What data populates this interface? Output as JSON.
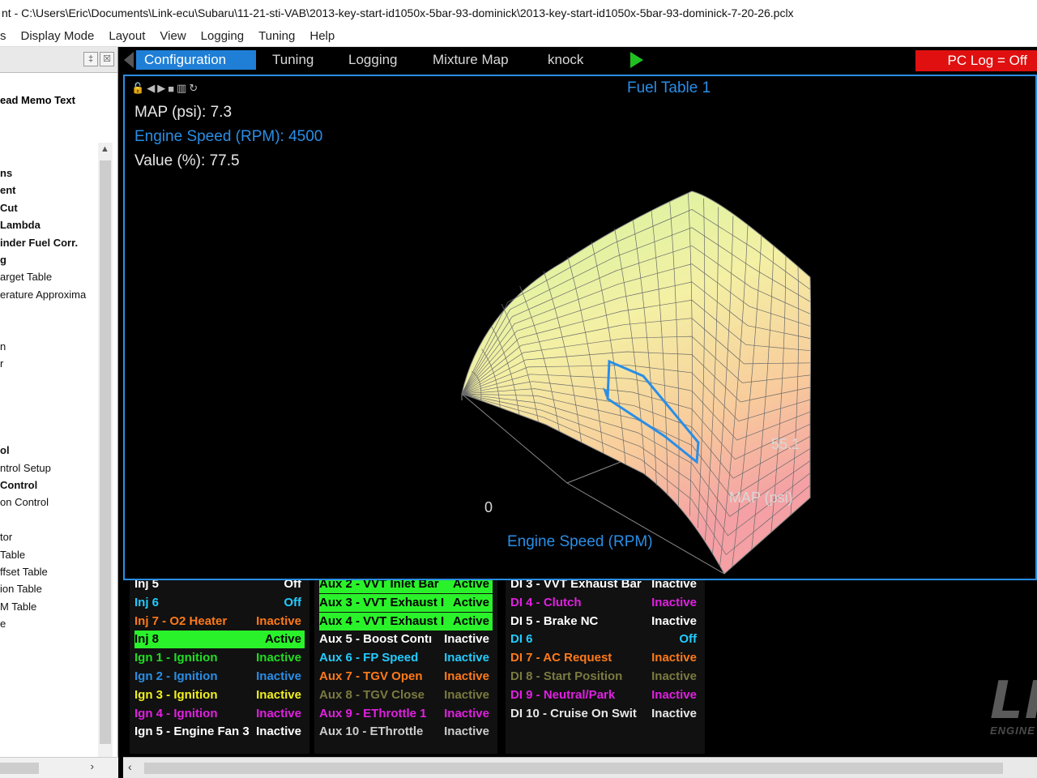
{
  "window": {
    "title": "nt - C:\\Users\\Eric\\Documents\\Link-ecu\\Subaru\\11-21-sti-VAB\\2013-key-start-id1050x-5bar-93-dominick\\2013-key-start-id1050x-5bar-93-dominick-7-20-26.pclx"
  },
  "menu": [
    "s",
    "Display Mode",
    "Layout",
    "View",
    "Logging",
    "Tuning",
    "Help"
  ],
  "left_panel": {
    "header": "ead Memo Text",
    "pin_label": "‡",
    "close_label": "☒",
    "items": [
      {
        "label": "ns",
        "bold": true
      },
      {
        "label": "ent",
        "bold": true
      },
      {
        "label": "Cut",
        "bold": true
      },
      {
        "label": "Lambda",
        "bold": true
      },
      {
        "label": "inder Fuel Corr.",
        "bold": true
      },
      {
        "label": "g",
        "bold": true
      },
      {
        "label": "arget Table",
        "bold": false
      },
      {
        "label": "erature Approxima",
        "bold": false
      },
      {
        "label": "",
        "bold": false
      },
      {
        "label": "",
        "bold": false
      },
      {
        "label": "n",
        "bold": false
      },
      {
        "label": "r",
        "bold": false
      },
      {
        "label": "",
        "bold": false
      },
      {
        "label": "",
        "bold": false
      },
      {
        "label": "",
        "bold": false
      },
      {
        "label": "",
        "bold": false
      },
      {
        "label": "ol",
        "bold": true
      },
      {
        "label": "ntrol Setup",
        "bold": false
      },
      {
        "label": "Control",
        "bold": true
      },
      {
        "label": "on Control",
        "bold": false
      },
      {
        "label": "",
        "bold": false
      },
      {
        "label": "tor",
        "bold": false
      },
      {
        "label": "Table",
        "bold": false
      },
      {
        "label": "ffset Table",
        "bold": false
      },
      {
        "label": "ion Table",
        "bold": false
      },
      {
        "label": "M Table",
        "bold": false
      },
      {
        "label": "e",
        "bold": false
      }
    ]
  },
  "tabs": [
    {
      "label": "Configuration",
      "active": true
    },
    {
      "label": "Tuning",
      "active": false
    },
    {
      "label": "Logging",
      "active": false
    },
    {
      "label": "Mixture Map",
      "active": false
    },
    {
      "label": "knock",
      "active": false
    }
  ],
  "pc_log": "PC Log = Off",
  "table_view": {
    "title": "Fuel Table 1",
    "readouts": {
      "map": "MAP (psi): 7.3",
      "rpm": "Engine Speed (RPM): 4500",
      "value": "Value (%): 77.5"
    },
    "axis_labels": {
      "x_axis": "Engine Speed (RPM)",
      "y_axis": "MAP (psi)",
      "y_max": "55.1",
      "x_min": "0"
    }
  },
  "status_columns": [
    {
      "rows": [
        {
          "name": "Inj 5",
          "state": "Off",
          "color": "#ffffff"
        },
        {
          "name": "Inj 6",
          "state": "Off",
          "color": "#22ccff"
        },
        {
          "name": "Inj 7 - O2 Heater",
          "state": "Inactive",
          "color": "#ff7a1a"
        },
        {
          "name": "Inj 8",
          "state": "Active",
          "color": "#000000",
          "highlight": true
        },
        {
          "name": "Ign 1 - Ignition",
          "state": "Inactive",
          "color": "#22dd22"
        },
        {
          "name": "Ign 2 - Ignition",
          "state": "Inactive",
          "color": "#2a8ee6"
        },
        {
          "name": "Ign 3 - Ignition",
          "state": "Inactive",
          "color": "#f0f020"
        },
        {
          "name": "Ign 4 - Ignition",
          "state": "Inactive",
          "color": "#e020e0"
        },
        {
          "name": "Ign 5 - Engine Fan 3",
          "state": "Inactive",
          "color": "#ffffff"
        }
      ]
    },
    {
      "rows": [
        {
          "name": "Aux 2 - VVT Inlet Bar",
          "state": "Active",
          "color": "#000000",
          "highlight": true
        },
        {
          "name": "Aux 3 - VVT Exhaust I",
          "state": "Active",
          "color": "#000000",
          "highlight": true
        },
        {
          "name": "Aux 4 - VVT Exhaust I",
          "state": "Active",
          "color": "#000000",
          "highlight": true
        },
        {
          "name": "Aux 5 - Boost Contı",
          "state": "Inactive",
          "color": "#ffffff"
        },
        {
          "name": "Aux 6 - FP Speed",
          "state": "Inactive",
          "color": "#22ccff"
        },
        {
          "name": "Aux 7 - TGV Open",
          "state": "Inactive",
          "color": "#ff7a1a"
        },
        {
          "name": "Aux 8 - TGV Close",
          "state": "Inactive",
          "color": "#7a7a40"
        },
        {
          "name": "Aux 9 - EThrottle 1",
          "state": "Inactive",
          "color": "#e020e0"
        },
        {
          "name": "Aux 10 - EThrottle ",
          "state": "Inactive",
          "color": "#cccccc"
        }
      ]
    },
    {
      "rows": [
        {
          "name": "DI 3 - VVT Exhaust Bar",
          "state": "Inactive",
          "color": "#ffffff"
        },
        {
          "name": "DI 4 - Clutch",
          "state": "Inactive",
          "color": "#e020e0"
        },
        {
          "name": "DI 5 - Brake NC",
          "state": "Inactive",
          "color": "#ffffff"
        },
        {
          "name": "DI 6",
          "state": "Off",
          "color": "#22ccff"
        },
        {
          "name": "DI 7 - AC Request",
          "state": "Inactive",
          "color": "#ff7a1a"
        },
        {
          "name": "DI 8 - Start Position",
          "state": "Inactive",
          "color": "#7a7a40"
        },
        {
          "name": "DI 9 - Neutral/Park",
          "state": "Inactive",
          "color": "#e020e0"
        },
        {
          "name": "DI 10 - Cruise On Swit",
          "state": "Inactive",
          "color": "#e8e8e8"
        }
      ]
    }
  ],
  "logo": {
    "text": "LIN",
    "subtitle": "ENGINE MANAGEME"
  },
  "colors": {
    "accent": "#2a8ee6",
    "active_green": "#2af22a",
    "pclog_red": "#e01010",
    "play_green": "#20c020"
  }
}
